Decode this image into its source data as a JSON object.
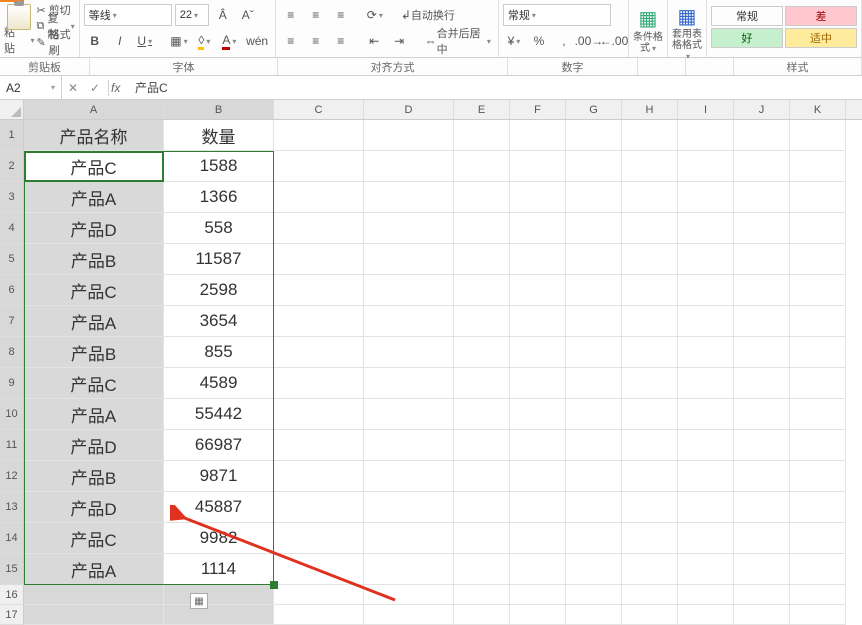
{
  "ribbon": {
    "clipboard": {
      "paste": "粘贴",
      "cut": "剪切",
      "copy": "复制",
      "format_painter": "格式刷",
      "group": "剪贴板"
    },
    "font": {
      "name": "等线",
      "size": "22",
      "bold": "B",
      "italic": "I",
      "underline": "U",
      "group": "字体"
    },
    "align": {
      "wrap": "自动换行",
      "merge": "合并后居中",
      "group": "对齐方式"
    },
    "number": {
      "format": "常规",
      "group": "数字"
    },
    "cond_format": "条件格式",
    "table_format": "套用表格格式",
    "styles": {
      "normal": "常规",
      "bad": "差",
      "good": "好",
      "neutral": "适中",
      "group": "样式"
    }
  },
  "formula_bar": {
    "cell_ref": "A2",
    "fx": "fx",
    "content": "产品C"
  },
  "columns": [
    "A",
    "B",
    "C",
    "D",
    "E",
    "F",
    "G",
    "H",
    "I",
    "J",
    "K"
  ],
  "rows": [
    "1",
    "2",
    "3",
    "4",
    "5",
    "6",
    "7",
    "8",
    "9",
    "10",
    "11",
    "12",
    "13",
    "14",
    "15",
    "16",
    "17"
  ],
  "sheet": {
    "header": {
      "name": "产品名称",
      "qty": "数量"
    },
    "data": [
      {
        "name": "产品C",
        "qty": "1588"
      },
      {
        "name": "产品A",
        "qty": "1366"
      },
      {
        "name": "产品D",
        "qty": "558"
      },
      {
        "name": "产品B",
        "qty": "11587"
      },
      {
        "name": "产品C",
        "qty": "2598"
      },
      {
        "name": "产品A",
        "qty": "3654"
      },
      {
        "name": "产品B",
        "qty": "855"
      },
      {
        "name": "产品C",
        "qty": "4589"
      },
      {
        "name": "产品A",
        "qty": "55442"
      },
      {
        "name": "产品D",
        "qty": "66987"
      },
      {
        "name": "产品B",
        "qty": "9871"
      },
      {
        "name": "产品D",
        "qty": "45887"
      },
      {
        "name": "产品C",
        "qty": "9982"
      },
      {
        "name": "产品A",
        "qty": "1114"
      }
    ]
  },
  "chart_data": {
    "type": "table",
    "title": "",
    "columns": [
      "产品名称",
      "数量"
    ],
    "rows": [
      [
        "产品C",
        1588
      ],
      [
        "产品A",
        1366
      ],
      [
        "产品D",
        558
      ],
      [
        "产品B",
        11587
      ],
      [
        "产品C",
        2598
      ],
      [
        "产品A",
        3654
      ],
      [
        "产品B",
        855
      ],
      [
        "产品C",
        4589
      ],
      [
        "产品A",
        55442
      ],
      [
        "产品D",
        66987
      ],
      [
        "产品B",
        9871
      ],
      [
        "产品D",
        45887
      ],
      [
        "产品C",
        9982
      ],
      [
        "产品A",
        1114
      ]
    ]
  }
}
